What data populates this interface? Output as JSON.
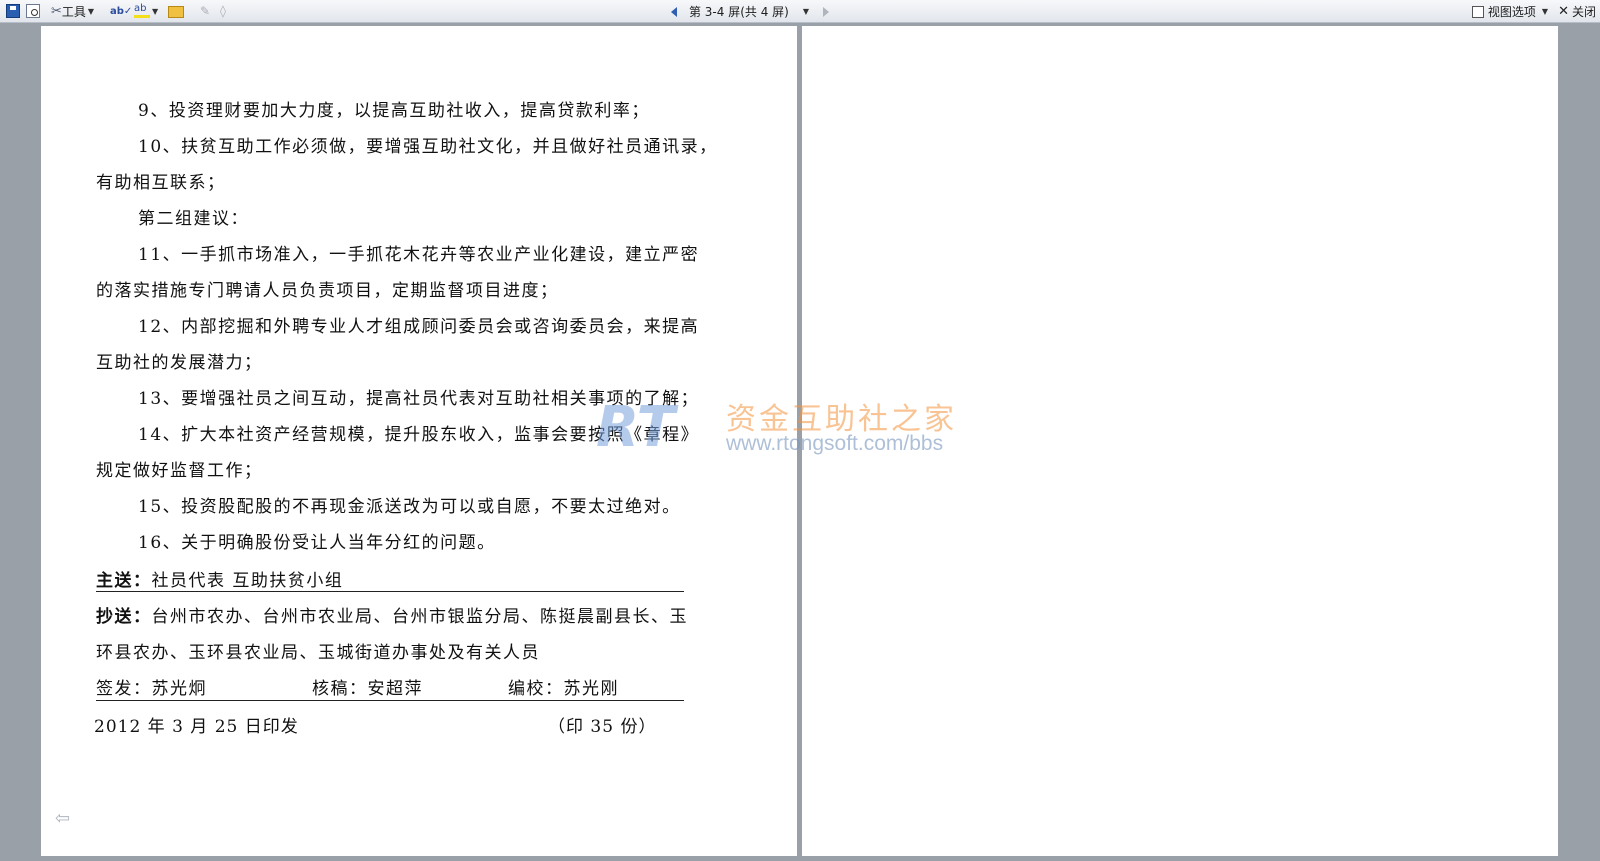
{
  "toolbar": {
    "tools_label": "工具",
    "nav_label": "第 3-4 屏(共 4 屏)",
    "view_options_label": "视图选项",
    "close_label": "关闭"
  },
  "document": {
    "lines": [
      "9、投资理财要加大力度，以提高互助社收入，提高贷款利率；",
      "10、扶贫互助工作必须做，要增强互助社文化，并且做好社员通讯录，",
      "有助相互联系；",
      "第二组建议：",
      "11、一手抓市场准入，一手抓花木花卉等农业产业化建设，建立严密",
      "的落实措施专门聘请人员负责项目，定期监督项目进度；",
      "12、内部挖掘和外聘专业人才组成顾问委员会或咨询委员会，来提高",
      "互助社的发展潜力；",
      "13、要增强社员之间互动，提高社员代表对互助社相关事项的了解；",
      "14、扩大本社资产经营规模，提升股东收入，监事会要按照《章程》",
      "规定做好监督工作；",
      "15、投资股配股的不再现金派送改为可以或自愿，不要太过绝对。",
      "16、关于明确股份受让人当年分红的问题。"
    ],
    "main_send_label": "主送：",
    "main_send_value": "社员代表   互助扶贫小组",
    "cc_label": "抄送：",
    "cc_line1": "台州市农办、台州市农业局、台州市银监分局、陈挺晨副县长、玉",
    "cc_line2": "环县农办、玉环县农业局、玉城街道办事处及有关人员",
    "signoff": "签发：苏光炯",
    "review": "核稿：安超萍",
    "edit": "编校：苏光刚",
    "date": "2012 年 3 月 25 日印发",
    "copies": "（印 35 份）"
  },
  "watermark": {
    "logo": "RT",
    "title": "资金互助社之家",
    "url": "www.rtongsoft.com/bbs"
  }
}
